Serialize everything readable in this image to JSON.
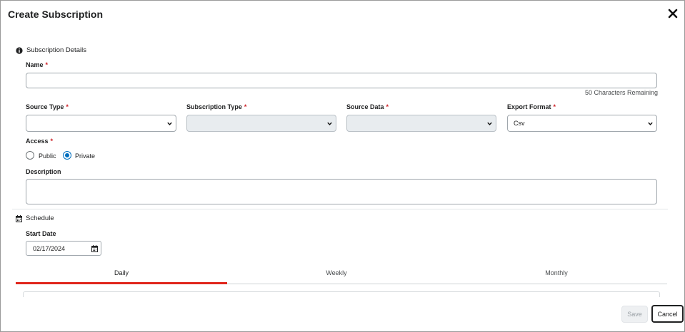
{
  "dialog": {
    "title": "Create Subscription"
  },
  "subscription_details": {
    "heading": "Subscription Details",
    "icon": "info-icon",
    "name": {
      "label": "Name",
      "required_mark": "*",
      "value": "",
      "helper": "50 Characters Remaining"
    },
    "source_type": {
      "label": "Source Type",
      "required_mark": "*",
      "selected": ""
    },
    "subscription_type": {
      "label": "Subscription Type",
      "required_mark": "*",
      "selected": ""
    },
    "source_data": {
      "label": "Source Data",
      "required_mark": "*",
      "selected": ""
    },
    "export_format": {
      "label": "Export Format",
      "required_mark": "*",
      "selected": "Csv"
    },
    "access": {
      "label": "Access",
      "required_mark": "*",
      "options": [
        "Public",
        "Private"
      ],
      "selected": "Private"
    },
    "description": {
      "label": "Description",
      "value": ""
    }
  },
  "schedule": {
    "heading": "Schedule",
    "icon": "calendar-icon",
    "start_date": {
      "label": "Start Date",
      "value": "02/17/2024"
    },
    "tabs": [
      {
        "label": "Daily",
        "active": true
      },
      {
        "label": "Weekly",
        "active": false
      },
      {
        "label": "Monthly",
        "active": false
      }
    ]
  },
  "footer": {
    "save_label": "Save",
    "cancel_label": "Cancel"
  },
  "colors": {
    "required": "#cd2026",
    "accent": "#006fbf",
    "active_tab": "#e0251b",
    "disabled_field": "#e8ecef"
  }
}
